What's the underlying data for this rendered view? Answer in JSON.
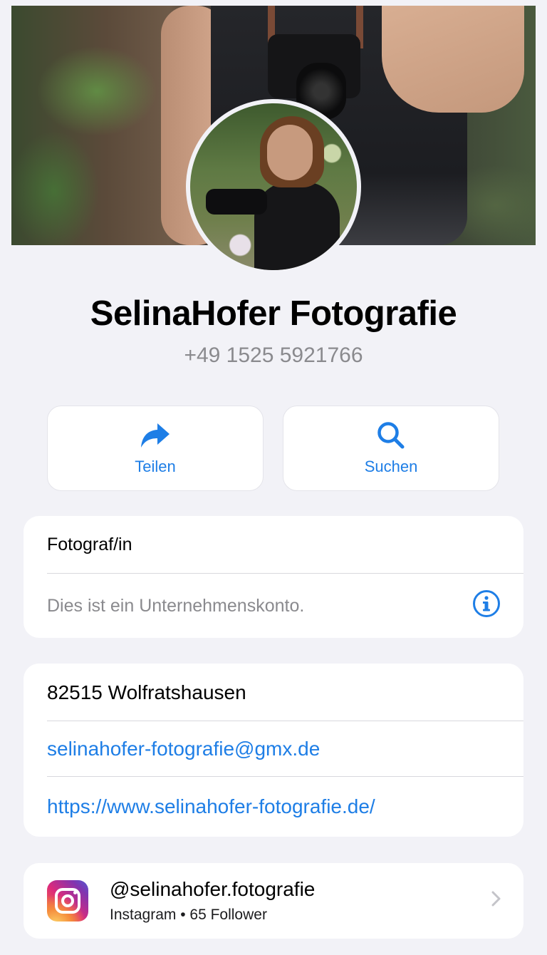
{
  "profile": {
    "name": "SelinaHofer Fotografie",
    "phone": "+49 1525 5921766"
  },
  "actions": {
    "share_label": "Teilen",
    "search_label": "Suchen"
  },
  "category_card": {
    "category": "Fotograf/in",
    "account_note": "Dies ist ein Unternehmenskonto."
  },
  "contact_card": {
    "address": "82515 Wolfratshausen",
    "email": "selinahofer-fotografie@gmx.de",
    "website": "https://www.selinahofer-fotografie.de/"
  },
  "instagram": {
    "handle": "@selinahofer.fotografie",
    "meta": "Instagram • 65 Follower"
  },
  "icons": {
    "share": "share-arrow-icon",
    "search": "magnifier-icon",
    "info": "info-circle-icon",
    "instagram": "instagram-logo-icon",
    "chevron": "chevron-right-icon"
  },
  "colors": {
    "accent": "#1e7ee6",
    "background": "#f2f2f7",
    "secondary_text": "#8a8a8e"
  }
}
